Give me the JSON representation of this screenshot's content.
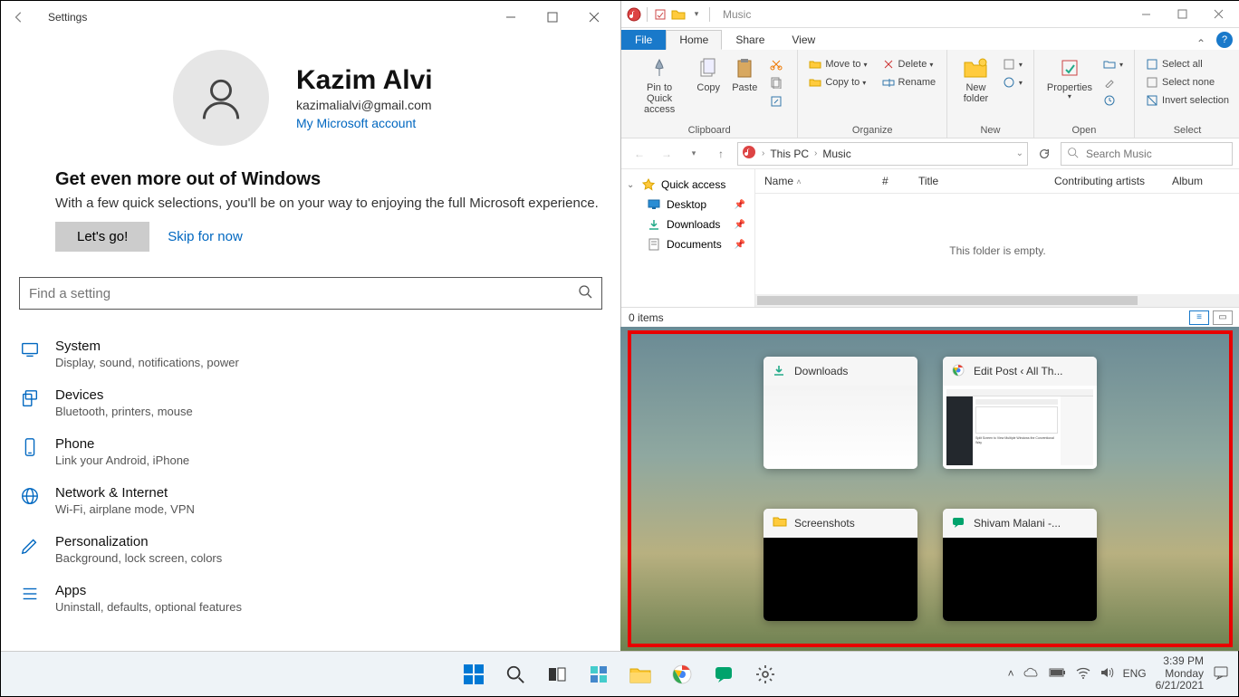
{
  "settings": {
    "title": "Settings",
    "profile": {
      "name": "Kazim Alvi",
      "email": "kazimalialvi@gmail.com",
      "ms_account_link": "My Microsoft account"
    },
    "promo": {
      "heading": "Get even more out of Windows",
      "body": "With a few quick selections, you'll be on your way to enjoying the full Microsoft experience.",
      "button": "Let's go!",
      "skip": "Skip for now"
    },
    "search_placeholder": "Find a setting",
    "categories": [
      {
        "title": "System",
        "desc": "Display, sound, notifications, power"
      },
      {
        "title": "Devices",
        "desc": "Bluetooth, printers, mouse"
      },
      {
        "title": "Phone",
        "desc": "Link your Android, iPhone"
      },
      {
        "title": "Network & Internet",
        "desc": "Wi-Fi, airplane mode, VPN"
      },
      {
        "title": "Personalization",
        "desc": "Background, lock screen, colors"
      },
      {
        "title": "Apps",
        "desc": "Uninstall, defaults, optional features"
      }
    ]
  },
  "explorer": {
    "window_title": "Music",
    "tabs": {
      "file": "File",
      "home": "Home",
      "share": "Share",
      "view": "View"
    },
    "ribbon": {
      "clipboard": {
        "label": "Clipboard",
        "pin": "Pin to Quick access",
        "copy": "Copy",
        "paste": "Paste"
      },
      "organize": {
        "label": "Organize",
        "move_to": "Move to",
        "copy_to": "Copy to",
        "delete": "Delete",
        "rename": "Rename"
      },
      "new": {
        "label": "New",
        "new_folder": "New folder"
      },
      "open": {
        "label": "Open",
        "properties": "Properties"
      },
      "select": {
        "label": "Select",
        "all": "Select all",
        "none": "Select none",
        "invert": "Invert selection"
      }
    },
    "breadcrumbs": [
      "This PC",
      "Music"
    ],
    "search_placeholder": "Search Music",
    "nav": {
      "quick_access": "Quick access",
      "items": [
        "Desktop",
        "Downloads",
        "Documents"
      ]
    },
    "columns": {
      "name": "Name",
      "num": "#",
      "title": "Title",
      "artists": "Contributing artists",
      "album": "Album"
    },
    "empty": "This folder is empty.",
    "status": "0 items"
  },
  "snap": {
    "tiles": [
      {
        "title": "Downloads"
      },
      {
        "title": "Edit Post ‹ All Th..."
      },
      {
        "title": "Screenshots"
      },
      {
        "title": "Shivam Malani -..."
      }
    ]
  },
  "taskbar": {
    "lang": "ENG",
    "time": "3:39 PM",
    "day": "Monday",
    "date": "6/21/2021"
  }
}
